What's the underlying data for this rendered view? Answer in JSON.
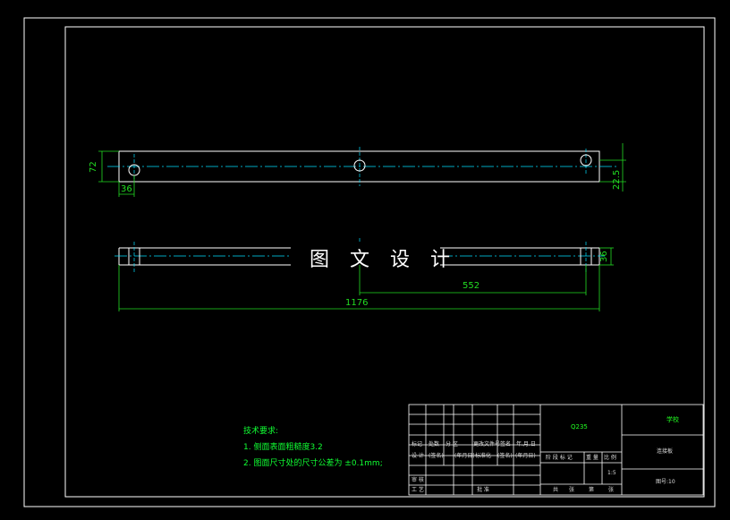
{
  "watermark": "图 文 设 计",
  "dimensions": {
    "height_left": "72",
    "hole_offset": "36",
    "offset_right": "22.5",
    "thickness": "36",
    "hole_spacing": "552",
    "overall_length": "1176"
  },
  "notes": {
    "title": "技术要求:",
    "items": [
      "1. 侧面表面粗糙度3.2",
      "2. 图面尺寸处的尺寸公差为 ±0.1mm;"
    ]
  },
  "title_block": {
    "material": "Q235",
    "company": "学校",
    "part_name": "连接板",
    "drawing_no": "图号:10",
    "scale": "1:5",
    "header_labels": [
      "标记",
      "处数",
      "分 区",
      "更改文件号",
      "签名",
      "年.月.日"
    ],
    "row2_labels": [
      "设 计",
      "(签名)",
      "(年月日)",
      "标准化",
      "(签名)",
      "(年月日)"
    ],
    "row_review": "审 核",
    "row_process": "工 艺",
    "row_approve": "批 准",
    "stage_labels": [
      "阶 段 标 记",
      "重 量",
      "比 例"
    ],
    "sheet_labels": [
      "共",
      "张",
      "第",
      "张"
    ]
  },
  "colors": {
    "background": "#000000",
    "lines": "#ffffff",
    "dimensions": "#00ff00",
    "centerlines": "#00ffff"
  }
}
